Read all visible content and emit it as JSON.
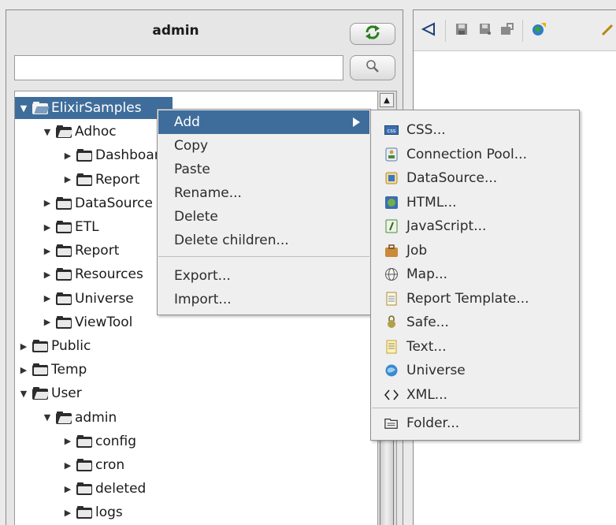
{
  "panel": {
    "title": "admin",
    "search_placeholder": ""
  },
  "tree": [
    {
      "label": "ElixirSamples",
      "level": 0,
      "expanded": true,
      "selected": true
    },
    {
      "label": "Adhoc",
      "level": 1,
      "expanded": true
    },
    {
      "label": "Dashboard",
      "level": 2,
      "expanded": false
    },
    {
      "label": "Report",
      "level": 2,
      "expanded": false
    },
    {
      "label": "DataSource",
      "level": 1,
      "expanded": false
    },
    {
      "label": "ETL",
      "level": 1,
      "expanded": false
    },
    {
      "label": "Report",
      "level": 1,
      "expanded": false
    },
    {
      "label": "Resources",
      "level": 1,
      "expanded": false
    },
    {
      "label": "Universe",
      "level": 1,
      "expanded": false
    },
    {
      "label": "ViewTool",
      "level": 1,
      "expanded": false
    },
    {
      "label": "Public",
      "level": 0,
      "expanded": false
    },
    {
      "label": "Temp",
      "level": 0,
      "expanded": false
    },
    {
      "label": "User",
      "level": 0,
      "expanded": true
    },
    {
      "label": "admin",
      "level": 1,
      "expanded": true
    },
    {
      "label": "config",
      "level": 2,
      "expanded": false
    },
    {
      "label": "cron",
      "level": 2,
      "expanded": false
    },
    {
      "label": "deleted",
      "level": 2,
      "expanded": false
    },
    {
      "label": "logs",
      "level": 2,
      "expanded": false
    }
  ],
  "context_menu": {
    "items": [
      {
        "label": "Add",
        "submenu": true,
        "active": true
      },
      {
        "label": "Copy"
      },
      {
        "label": "Paste"
      },
      {
        "label": "Rename..."
      },
      {
        "label": "Delete"
      },
      {
        "label": "Delete children..."
      },
      {
        "label": "Export..."
      },
      {
        "label": "Import..."
      }
    ]
  },
  "submenu": {
    "items": [
      {
        "label": "CSS...",
        "icon": "css-icon"
      },
      {
        "label": "Connection Pool...",
        "icon": "connection-pool-icon"
      },
      {
        "label": "DataSource...",
        "icon": "datasource-icon"
      },
      {
        "label": "HTML...",
        "icon": "html-icon"
      },
      {
        "label": "JavaScript...",
        "icon": "javascript-icon"
      },
      {
        "label": "Job",
        "icon": "job-icon"
      },
      {
        "label": "Map...",
        "icon": "map-icon"
      },
      {
        "label": "Report Template...",
        "icon": "report-template-icon"
      },
      {
        "label": "Safe...",
        "icon": "safe-icon"
      },
      {
        "label": "Text...",
        "icon": "text-icon"
      },
      {
        "label": "Universe",
        "icon": "universe-icon"
      },
      {
        "label": "XML...",
        "icon": "xml-icon"
      },
      {
        "label": "Folder...",
        "icon": "folder-icon"
      }
    ],
    "css_badge": "css"
  },
  "toolbar": {
    "icons": [
      "back-icon",
      "save-icon",
      "save-as-icon",
      "lock-icon",
      "publish-icon",
      "tools-icon"
    ]
  },
  "colors": {
    "selection": "#3f6d9b",
    "panel_bg": "#e6e6e6",
    "menu_bg": "#efefef"
  }
}
